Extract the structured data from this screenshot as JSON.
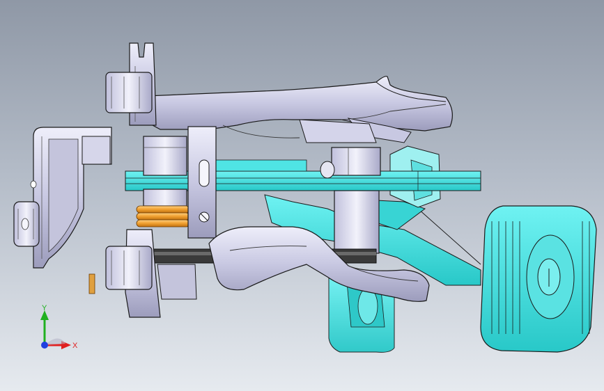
{
  "viewport": {
    "background_top": "#8f98a6",
    "background_bottom": "#e6eaef"
  },
  "colors": {
    "body_light": "#dcdcf0",
    "body_mid": "#b9b9d8",
    "body_dark": "#8a8aa8",
    "edge": "#1a1a1a",
    "pedal_cyan": "#40e6e6",
    "pedal_cyan_dark": "#20b8b8",
    "spring_orange": "#f0a030",
    "pin_orange": "#e0a040",
    "dark_rod": "#2a2a2a"
  },
  "triad": {
    "x_label": "X",
    "y_label": "Y",
    "x_color": "#e02020",
    "y_color": "#20b020",
    "z_color": "#2040e0",
    "icon": "coordinate-triad-icon"
  }
}
